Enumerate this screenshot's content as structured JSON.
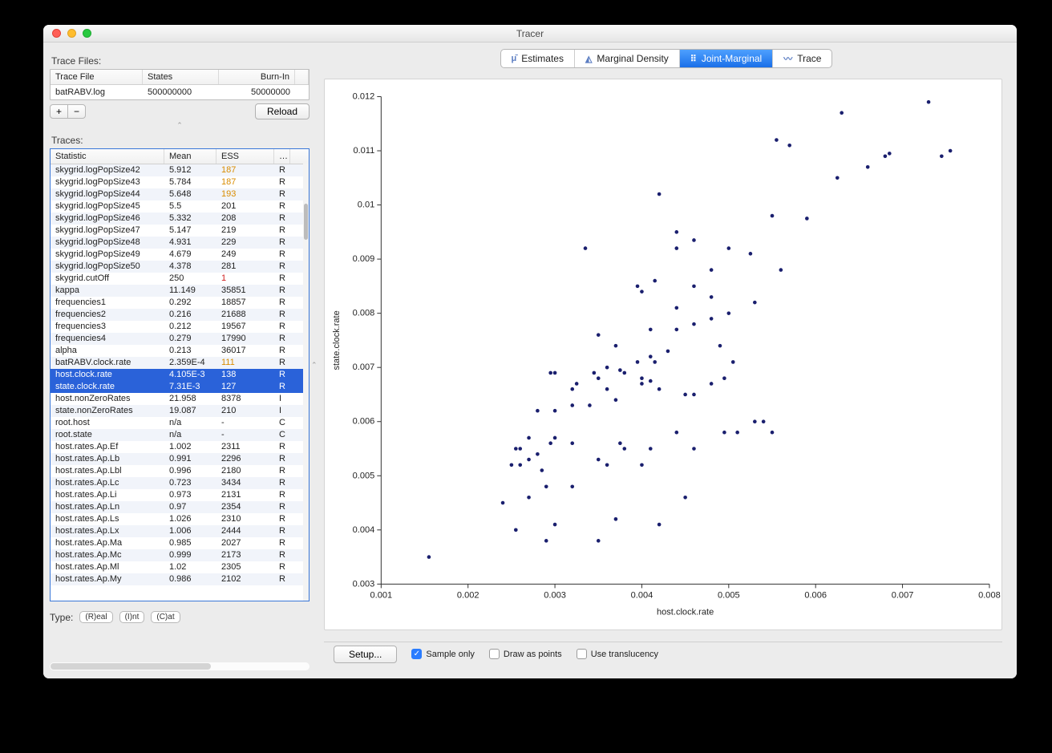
{
  "window": {
    "title": "Tracer"
  },
  "left": {
    "trace_files_label": "Trace Files:",
    "file_headers": {
      "file": "Trace File",
      "states": "States",
      "burn": "Burn-In"
    },
    "file_row": {
      "file": "batRABV.log",
      "states": "500000000",
      "burn": "50000000"
    },
    "plus": "+",
    "minus": "−",
    "reload": "Reload",
    "traces_label": "Traces:",
    "trace_headers": {
      "stat": "Statistic",
      "mean": "Mean",
      "ess": "ESS",
      "more": "…"
    },
    "traces": [
      {
        "stat": "skygrid.logPopSize42",
        "mean": "5.912",
        "ess": "187",
        "type": "R",
        "ess_cls": "warn",
        "alt": true
      },
      {
        "stat": "skygrid.logPopSize43",
        "mean": "5.784",
        "ess": "187",
        "type": "R",
        "ess_cls": "warn",
        "alt": false
      },
      {
        "stat": "skygrid.logPopSize44",
        "mean": "5.648",
        "ess": "193",
        "type": "R",
        "ess_cls": "warn",
        "alt": true
      },
      {
        "stat": "skygrid.logPopSize45",
        "mean": "5.5",
        "ess": "201",
        "type": "R",
        "ess_cls": "",
        "alt": false
      },
      {
        "stat": "skygrid.logPopSize46",
        "mean": "5.332",
        "ess": "208",
        "type": "R",
        "ess_cls": "",
        "alt": true
      },
      {
        "stat": "skygrid.logPopSize47",
        "mean": "5.147",
        "ess": "219",
        "type": "R",
        "ess_cls": "",
        "alt": false
      },
      {
        "stat": "skygrid.logPopSize48",
        "mean": "4.931",
        "ess": "229",
        "type": "R",
        "ess_cls": "",
        "alt": true
      },
      {
        "stat": "skygrid.logPopSize49",
        "mean": "4.679",
        "ess": "249",
        "type": "R",
        "ess_cls": "",
        "alt": false
      },
      {
        "stat": "skygrid.logPopSize50",
        "mean": "4.378",
        "ess": "281",
        "type": "R",
        "ess_cls": "",
        "alt": true
      },
      {
        "stat": "skygrid.cutOff",
        "mean": "250",
        "ess": "1",
        "type": "R",
        "ess_cls": "bad",
        "alt": false
      },
      {
        "stat": "kappa",
        "mean": "11.149",
        "ess": "35851",
        "type": "R",
        "ess_cls": "",
        "alt": true
      },
      {
        "stat": "frequencies1",
        "mean": "0.292",
        "ess": "18857",
        "type": "R",
        "ess_cls": "",
        "alt": false
      },
      {
        "stat": "frequencies2",
        "mean": "0.216",
        "ess": "21688",
        "type": "R",
        "ess_cls": "",
        "alt": true
      },
      {
        "stat": "frequencies3",
        "mean": "0.212",
        "ess": "19567",
        "type": "R",
        "ess_cls": "",
        "alt": false
      },
      {
        "stat": "frequencies4",
        "mean": "0.279",
        "ess": "17990",
        "type": "R",
        "ess_cls": "",
        "alt": true
      },
      {
        "stat": "alpha",
        "mean": "0.213",
        "ess": "36017",
        "type": "R",
        "ess_cls": "",
        "alt": false
      },
      {
        "stat": "batRABV.clock.rate",
        "mean": "2.359E-4",
        "ess": "111",
        "type": "R",
        "ess_cls": "warn",
        "alt": true
      },
      {
        "stat": "host.clock.rate",
        "mean": "4.105E-3",
        "ess": "138",
        "type": "R",
        "ess_cls": "warn",
        "alt": false,
        "sel": true
      },
      {
        "stat": "state.clock.rate",
        "mean": "7.31E-3",
        "ess": "127",
        "type": "R",
        "ess_cls": "warn",
        "alt": true,
        "sel": true
      },
      {
        "stat": "host.nonZeroRates",
        "mean": "21.958",
        "ess": "8378",
        "type": "I",
        "ess_cls": "",
        "alt": false
      },
      {
        "stat": "state.nonZeroRates",
        "mean": "19.087",
        "ess": "210",
        "type": "I",
        "ess_cls": "",
        "alt": true
      },
      {
        "stat": "root.host",
        "mean": "n/a",
        "ess": "-",
        "type": "C",
        "ess_cls": "",
        "alt": false
      },
      {
        "stat": "root.state",
        "mean": "n/a",
        "ess": "-",
        "type": "C",
        "ess_cls": "",
        "alt": true
      },
      {
        "stat": "host.rates.Ap.Ef",
        "mean": "1.002",
        "ess": "2311",
        "type": "R",
        "ess_cls": "",
        "alt": false
      },
      {
        "stat": "host.rates.Ap.Lb",
        "mean": "0.991",
        "ess": "2296",
        "type": "R",
        "ess_cls": "",
        "alt": true
      },
      {
        "stat": "host.rates.Ap.Lbl",
        "mean": "0.996",
        "ess": "2180",
        "type": "R",
        "ess_cls": "",
        "alt": false
      },
      {
        "stat": "host.rates.Ap.Lc",
        "mean": "0.723",
        "ess": "3434",
        "type": "R",
        "ess_cls": "",
        "alt": true
      },
      {
        "stat": "host.rates.Ap.Li",
        "mean": "0.973",
        "ess": "2131",
        "type": "R",
        "ess_cls": "",
        "alt": false
      },
      {
        "stat": "host.rates.Ap.Ln",
        "mean": "0.97",
        "ess": "2354",
        "type": "R",
        "ess_cls": "",
        "alt": true
      },
      {
        "stat": "host.rates.Ap.Ls",
        "mean": "1.026",
        "ess": "2310",
        "type": "R",
        "ess_cls": "",
        "alt": false
      },
      {
        "stat": "host.rates.Ap.Lx",
        "mean": "1.006",
        "ess": "2444",
        "type": "R",
        "ess_cls": "",
        "alt": true
      },
      {
        "stat": "host.rates.Ap.Ma",
        "mean": "0.985",
        "ess": "2027",
        "type": "R",
        "ess_cls": "",
        "alt": false
      },
      {
        "stat": "host.rates.Ap.Mc",
        "mean": "0.999",
        "ess": "2173",
        "type": "R",
        "ess_cls": "",
        "alt": true
      },
      {
        "stat": "host.rates.Ap.Ml",
        "mean": "1.02",
        "ess": "2305",
        "type": "R",
        "ess_cls": "",
        "alt": false
      },
      {
        "stat": "host.rates.Ap.My",
        "mean": "0.986",
        "ess": "2102",
        "type": "R",
        "ess_cls": "",
        "alt": true
      }
    ],
    "type_label": "Type:",
    "type_real": "(R)eal",
    "type_int": "(I)nt",
    "type_cat": "(C)at"
  },
  "tabs": {
    "estimates": "Estimates",
    "marginal": "Marginal Density",
    "joint": "Joint-Marginal",
    "trace": "Trace"
  },
  "footer": {
    "setup": "Setup...",
    "sample_only": "Sample only",
    "draw_points": "Draw as points",
    "translucency": "Use translucency"
  },
  "chart_data": {
    "type": "scatter",
    "xlabel": "host.clock.rate",
    "ylabel": "state.clock.rate",
    "xlim": [
      0.001,
      0.008
    ],
    "ylim": [
      0.003,
      0.012
    ],
    "xticks": [
      0.001,
      0.002,
      0.003,
      0.004,
      0.005,
      0.006,
      0.007,
      0.008
    ],
    "yticks": [
      0.003,
      0.004,
      0.005,
      0.006,
      0.007,
      0.008,
      0.009,
      0.01,
      0.011,
      0.012
    ],
    "points": [
      [
        0.00155,
        0.0035
      ],
      [
        0.0029,
        0.0038
      ],
      [
        0.0035,
        0.0038
      ],
      [
        0.00255,
        0.004
      ],
      [
        0.003,
        0.0041
      ],
      [
        0.0037,
        0.0042
      ],
      [
        0.0042,
        0.0041
      ],
      [
        0.0024,
        0.0045
      ],
      [
        0.0027,
        0.0046
      ],
      [
        0.0029,
        0.0048
      ],
      [
        0.0032,
        0.0048
      ],
      [
        0.0045,
        0.0046
      ],
      [
        0.0025,
        0.0052
      ],
      [
        0.0026,
        0.0052
      ],
      [
        0.00285,
        0.0051
      ],
      [
        0.0027,
        0.0053
      ],
      [
        0.0028,
        0.0054
      ],
      [
        0.0026,
        0.0055
      ],
      [
        0.00255,
        0.0055
      ],
      [
        0.0027,
        0.0057
      ],
      [
        0.003,
        0.0057
      ],
      [
        0.00295,
        0.0056
      ],
      [
        0.0032,
        0.0056
      ],
      [
        0.0035,
        0.0053
      ],
      [
        0.0036,
        0.0052
      ],
      [
        0.00375,
        0.0056
      ],
      [
        0.0038,
        0.0055
      ],
      [
        0.004,
        0.0052
      ],
      [
        0.0041,
        0.0055
      ],
      [
        0.0044,
        0.0058
      ],
      [
        0.0046,
        0.0055
      ],
      [
        0.00495,
        0.0058
      ],
      [
        0.0051,
        0.0058
      ],
      [
        0.0053,
        0.006
      ],
      [
        0.0054,
        0.006
      ],
      [
        0.0055,
        0.0058
      ],
      [
        0.0028,
        0.0062
      ],
      [
        0.003,
        0.0062
      ],
      [
        0.0032,
        0.0063
      ],
      [
        0.0034,
        0.0063
      ],
      [
        0.0037,
        0.0064
      ],
      [
        0.0036,
        0.0066
      ],
      [
        0.0032,
        0.0066
      ],
      [
        0.0035,
        0.0068
      ],
      [
        0.00345,
        0.0069
      ],
      [
        0.003,
        0.0069
      ],
      [
        0.00295,
        0.0069
      ],
      [
        0.00325,
        0.0067
      ],
      [
        0.0036,
        0.007
      ],
      [
        0.0038,
        0.0069
      ],
      [
        0.00375,
        0.00695
      ],
      [
        0.004,
        0.0067
      ],
      [
        0.004,
        0.0068
      ],
      [
        0.0041,
        0.00675
      ],
      [
        0.00395,
        0.0071
      ],
      [
        0.00415,
        0.0071
      ],
      [
        0.0042,
        0.0066
      ],
      [
        0.0045,
        0.0065
      ],
      [
        0.0046,
        0.0065
      ],
      [
        0.0048,
        0.0067
      ],
      [
        0.0041,
        0.0072
      ],
      [
        0.0043,
        0.0073
      ],
      [
        0.0037,
        0.0074
      ],
      [
        0.0035,
        0.0076
      ],
      [
        0.0041,
        0.0077
      ],
      [
        0.0044,
        0.0077
      ],
      [
        0.0046,
        0.0078
      ],
      [
        0.0048,
        0.0079
      ],
      [
        0.0049,
        0.0074
      ],
      [
        0.00505,
        0.0071
      ],
      [
        0.00495,
        0.0068
      ],
      [
        0.0044,
        0.0081
      ],
      [
        0.004,
        0.0084
      ],
      [
        0.00395,
        0.0085
      ],
      [
        0.00415,
        0.0086
      ],
      [
        0.0048,
        0.0083
      ],
      [
        0.0048,
        0.0088
      ],
      [
        0.005,
        0.0092
      ],
      [
        0.0044,
        0.0092
      ],
      [
        0.0046,
        0.00935
      ],
      [
        0.00335,
        0.0092
      ],
      [
        0.0042,
        0.0102
      ],
      [
        0.0057,
        0.0111
      ],
      [
        0.00555,
        0.0112
      ],
      [
        0.0063,
        0.0117
      ],
      [
        0.0073,
        0.0119
      ],
      [
        0.00755,
        0.011
      ],
      [
        0.00745,
        0.0109
      ],
      [
        0.0068,
        0.0109
      ],
      [
        0.00685,
        0.01095
      ],
      [
        0.0066,
        0.0107
      ],
      [
        0.00625,
        0.0105
      ],
      [
        0.0059,
        0.00975
      ],
      [
        0.0055,
        0.0098
      ],
      [
        0.005,
        0.008
      ],
      [
        0.0053,
        0.0082
      ],
      [
        0.0056,
        0.0088
      ],
      [
        0.00525,
        0.0091
      ],
      [
        0.0046,
        0.0085
      ],
      [
        0.0044,
        0.0095
      ]
    ]
  }
}
